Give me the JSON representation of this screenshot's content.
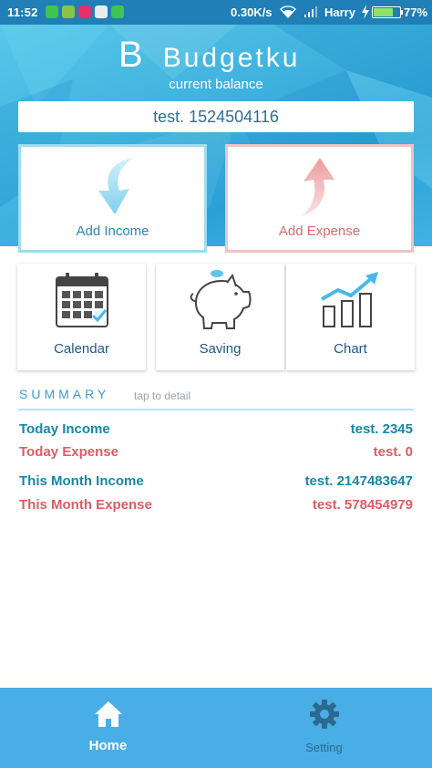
{
  "status_bar": {
    "time": "11:52",
    "speed": "0.30K/s",
    "carrier": "Harry",
    "battery": "77%",
    "battery_level": 0.77,
    "notification_icons": [
      "chat-icon",
      "android-icon",
      "instagram-icon",
      "mail-icon",
      "message-icon"
    ]
  },
  "header": {
    "logo_mark": "B",
    "app_name": "Budgetku",
    "balance_label": "current balance",
    "balance_value": "test. 1524504116"
  },
  "actions": {
    "income_label": "Add Income",
    "expense_label": "Add Expense"
  },
  "tools": {
    "calendar_label": "Calendar",
    "saving_label": "Saving",
    "chart_label": "Chart"
  },
  "summary": {
    "title": "SUMMARY",
    "hint": "tap to detail",
    "today_income_label": "Today Income",
    "today_income_value": "test. 2345",
    "today_expense_label": "Today Expense",
    "today_expense_value": "test. 0",
    "month_income_label": "This Month Income",
    "month_income_value": "test. 2147483647",
    "month_expense_label": "This Month Expense",
    "month_expense_value": "test. 578454979"
  },
  "nav": {
    "home_label": "Home",
    "setting_label": "Setting",
    "active": "Home"
  },
  "colors": {
    "header_blue": "#3fb2de",
    "income_blue": "#1786a8",
    "expense_red": "#dd5c62",
    "nav_blue": "#4aaee6"
  }
}
